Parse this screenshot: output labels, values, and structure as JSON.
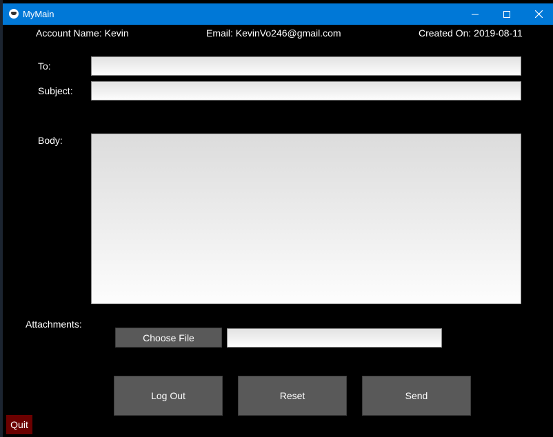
{
  "window": {
    "title": "MyMain",
    "app_icon": "app-logo-icon",
    "controls": {
      "minimize_icon": "minimize-icon",
      "maximize_icon": "maximize-icon",
      "close_icon": "close-icon"
    },
    "titlebar_color": "#0078d7"
  },
  "account": {
    "name_text": "Account Name: Kevin",
    "email_text": "Email: KevinVo246@gmail.com",
    "created_text": "Created On: 2019-08-11"
  },
  "form": {
    "to_label": "To:",
    "to_value": "",
    "subject_label": "Subject:",
    "subject_value": "",
    "body_label": "Body:",
    "body_value": "",
    "attachments_label": "Attachments:",
    "choose_file_label": "Choose File",
    "attachment_path": ""
  },
  "actions": {
    "logout_label": "Log Out",
    "reset_label": "Reset",
    "send_label": "Send",
    "quit_label": "Quit"
  },
  "colors": {
    "background": "#000000",
    "button": "#595959",
    "quit_button": "#6b0000"
  }
}
